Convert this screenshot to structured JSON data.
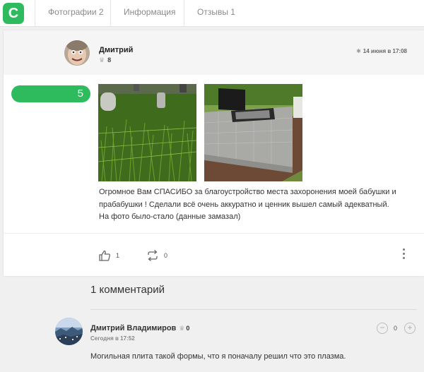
{
  "app": {
    "logo_letter": "С",
    "brand_color": "#2dbb5d"
  },
  "tabs": [
    {
      "label": "Фотографии 2"
    },
    {
      "label": "Информация"
    },
    {
      "label": "Отзывы 1"
    }
  ],
  "review": {
    "author_name": "Дмитрий",
    "author_score": "8",
    "date": "14 июня в 17:08",
    "rating": "5",
    "rating_fraction": 1.0,
    "text_lines": [
      "Огромное Вам СПАСИБО за благоустройство места захоронения моей бабушки и",
      "прабабушки ! Сделали всё очень аккуратно и ценник вышел самый адекватный.",
      "На фото было-стало (данные замазал)"
    ],
    "likes": "1",
    "shares": "0"
  },
  "comments": {
    "title": "1 комментарий",
    "items": [
      {
        "author_name": "Дмитрий Владимиров",
        "author_score": "0",
        "time": "Сегодня в 17:52",
        "text": "Могильная плита такой формы, что я поначалу решил что это плазма.",
        "votes": "0"
      }
    ]
  }
}
